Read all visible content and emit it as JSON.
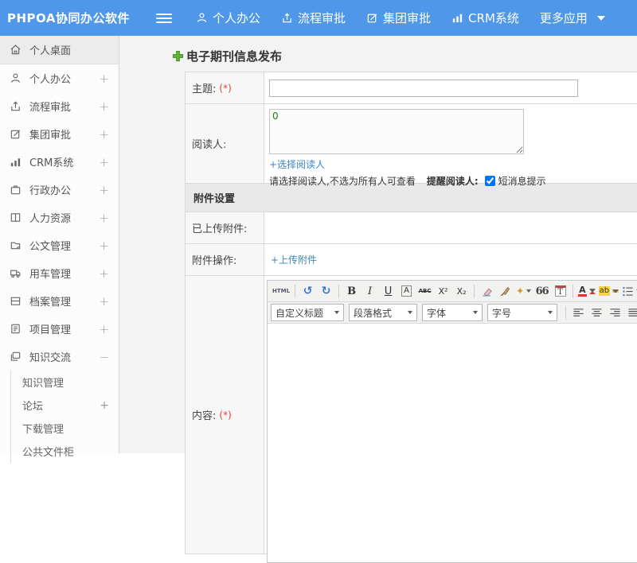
{
  "colors": {
    "header_blue": "#4e97e9",
    "link_blue": "#3a87c8",
    "required_red": "#e03e3e",
    "plus_green": "#5cb832",
    "readers_text_green": "#1e7a1e"
  },
  "header": {
    "logo": "PHPOA协同办公软件",
    "nav": [
      {
        "label": "个人办公"
      },
      {
        "label": "流程审批"
      },
      {
        "label": "集团审批"
      },
      {
        "label": "CRM系统"
      },
      {
        "label": "更多应用"
      }
    ]
  },
  "sidebar": {
    "items": [
      {
        "label": "个人桌面",
        "toggle": ""
      },
      {
        "label": "个人办公",
        "toggle": "+"
      },
      {
        "label": "流程审批",
        "toggle": "+"
      },
      {
        "label": "集团审批",
        "toggle": "+"
      },
      {
        "label": "CRM系统",
        "toggle": "+"
      },
      {
        "label": "行政办公",
        "toggle": "+"
      },
      {
        "label": "人力资源",
        "toggle": "+"
      },
      {
        "label": "公文管理",
        "toggle": "+"
      },
      {
        "label": "用车管理",
        "toggle": "+"
      },
      {
        "label": "档案管理",
        "toggle": "+"
      },
      {
        "label": "项目管理",
        "toggle": "+"
      },
      {
        "label": "知识交流",
        "toggle": "−"
      }
    ],
    "submenu": [
      {
        "label": "知识管理",
        "toggle": ""
      },
      {
        "label": "论坛",
        "toggle": "+"
      },
      {
        "label": "下载管理",
        "toggle": ""
      },
      {
        "label": "公共文件柜",
        "toggle": ""
      }
    ]
  },
  "main": {
    "page_title": "电子期刊信息发布",
    "form": {
      "subject_label": "主题:",
      "subject_required": "(*)",
      "readers_label": "阅读人:",
      "readers_value": "0",
      "select_readers_link": "+选择阅读人",
      "readers_hint": "请选择阅读人,不选为所有人可查看",
      "remind_label": "提醒阅读人:",
      "sms_label": "短消息提示",
      "sms_checked": "checked",
      "attachment_section_title": "附件设置",
      "uploaded_label": "已上传附件:",
      "action_label": "附件操作:",
      "upload_link": "+上传附件",
      "content_label": "内容:",
      "content_required": "(*)"
    }
  },
  "editor": {
    "buttons": {
      "html": "HTML",
      "undo": "↺",
      "redo": "↻",
      "bold": "B",
      "italic": "I",
      "underline": "U",
      "font_box": "A",
      "strikethrough": "ABC",
      "superscript": "X²",
      "subscript": "X₂",
      "quick_format": "✦",
      "blockquote": "66",
      "paste_text": "T",
      "forecolor": "A",
      "hilitecolor": "ab"
    },
    "selects": [
      {
        "label": "自定义标题"
      },
      {
        "label": "段落格式"
      },
      {
        "label": "字体"
      },
      {
        "label": "字号"
      }
    ]
  }
}
